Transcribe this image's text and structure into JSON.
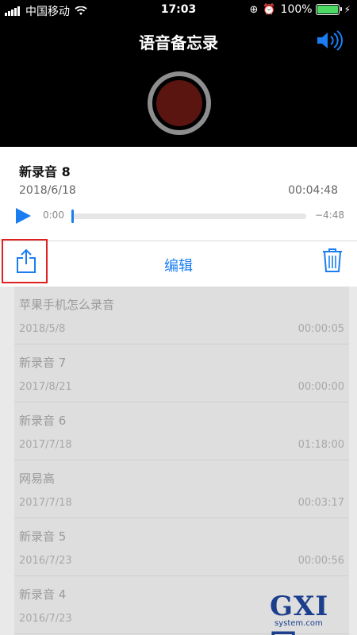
{
  "status": {
    "carrier": "中国移动",
    "time": "17:03",
    "battery": "100%",
    "battery_level": 1.0
  },
  "header": {
    "title": "语音备忘录"
  },
  "current": {
    "name": "新录音 8",
    "date": "2018/6/18",
    "duration": "00:04:48",
    "elapsed": "0:00",
    "remaining": "−4:48",
    "progress": 0.0
  },
  "toolbar": {
    "edit_label": "编辑"
  },
  "recordings": [
    {
      "name": "苹果手机怎么录音",
      "date": "2018/5/8",
      "duration": "00:00:05"
    },
    {
      "name": "新录音 7",
      "date": "2017/8/21",
      "duration": "00:00:00"
    },
    {
      "name": "新录音 6",
      "date": "2017/7/18",
      "duration": "01:18:00"
    },
    {
      "name": "网易高",
      "date": "2017/7/18",
      "duration": "00:03:17"
    },
    {
      "name": "新录音 5",
      "date": "2016/7/23",
      "duration": "00:00:56"
    },
    {
      "name": "新录音 4",
      "date": "2016/7/23",
      "duration": ""
    }
  ],
  "watermark": {
    "brand": "GXI网",
    "site": "system.com"
  },
  "colors": {
    "accent": "#1a7ef2",
    "record": "#5a1510",
    "highlight_box": "#e02020"
  }
}
